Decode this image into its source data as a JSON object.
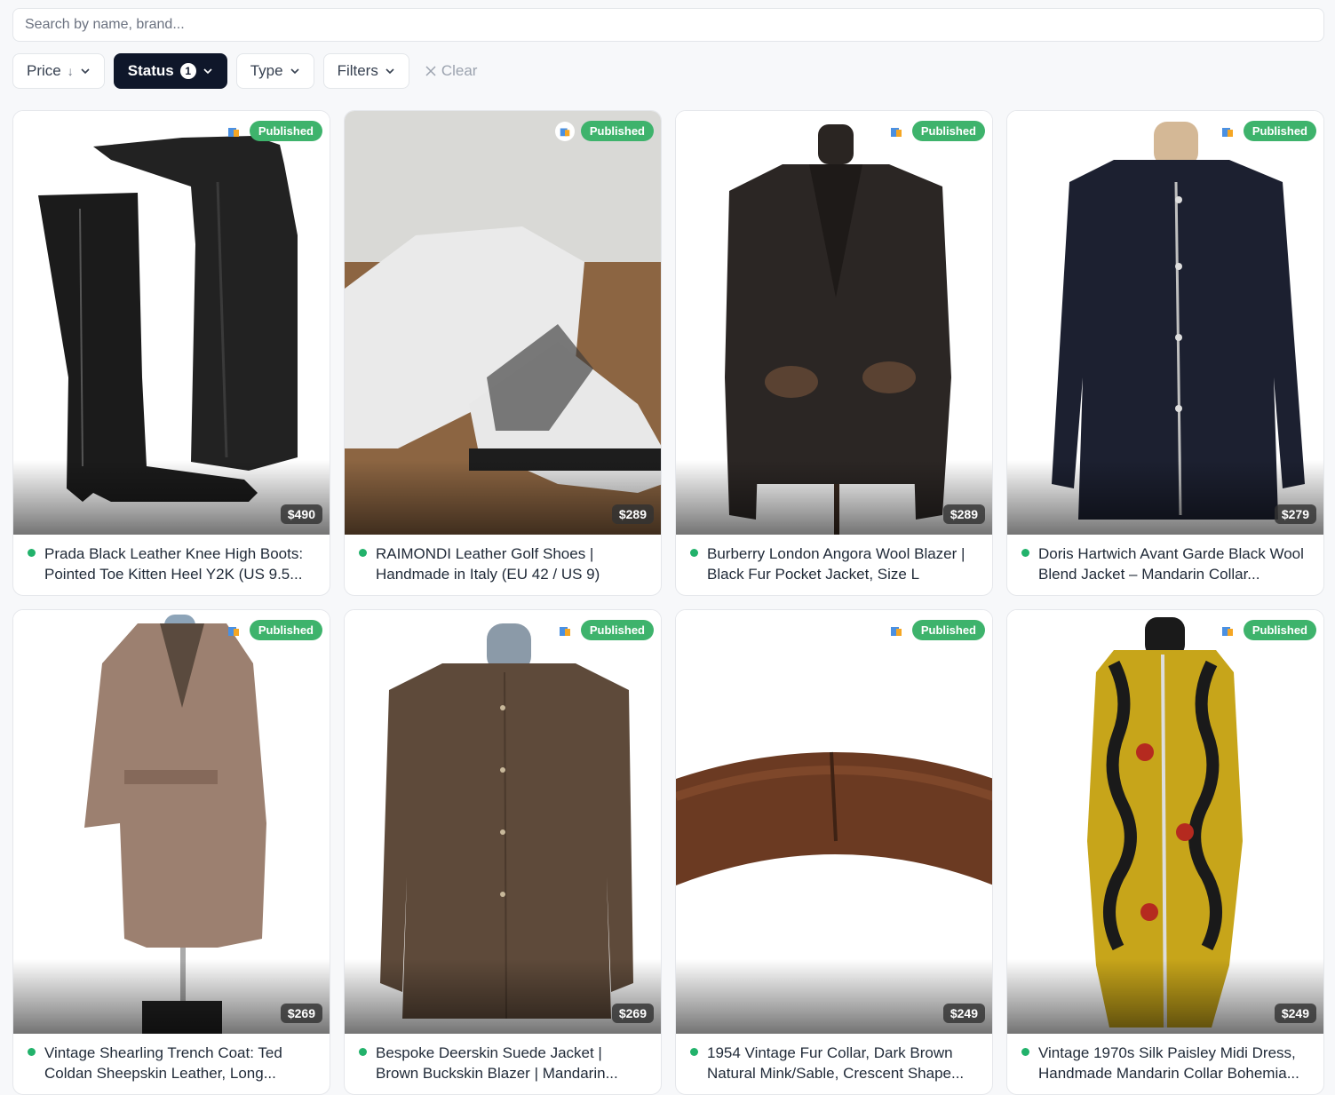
{
  "search": {
    "placeholder": "Search by name, brand..."
  },
  "filters": {
    "price": "Price",
    "status": "Status",
    "status_count": "1",
    "type": "Type",
    "more": "Filters",
    "clear": "Clear"
  },
  "products": [
    {
      "title": "Prada Black Leather Knee High Boots: Pointed Toe Kitten Heel Y2K (US 9.5...",
      "price": "$490",
      "status": "Published"
    },
    {
      "title": "RAIMONDI Leather Golf Shoes | Handmade in Italy (EU 42 / US 9)",
      "price": "$289",
      "status": "Published"
    },
    {
      "title": "Burberry London Angora Wool Blazer | Black Fur Pocket Jacket, Size L",
      "price": "$289",
      "status": "Published"
    },
    {
      "title": "Doris Hartwich Avant Garde Black Wool Blend Jacket – Mandarin Collar...",
      "price": "$279",
      "status": "Published"
    },
    {
      "title": "Vintage Shearling Trench Coat: Ted Coldan Sheepskin Leather, Long...",
      "price": "$269",
      "status": "Published"
    },
    {
      "title": "Bespoke Deerskin Suede Jacket | Brown Buckskin Blazer | Mandarin...",
      "price": "$269",
      "status": "Published"
    },
    {
      "title": "1954 Vintage Fur Collar, Dark Brown Natural Mink/Sable, Crescent Shape...",
      "price": "$249",
      "status": "Published"
    },
    {
      "title": "Vintage 1970s Silk Paisley Midi Dress, Handmade Mandarin Collar Bohemia...",
      "price": "$249",
      "status": "Published"
    }
  ],
  "colors": {
    "published": "#3eb36c",
    "active_filter": "#0f172a",
    "status_dot": "#22b26b"
  },
  "icons": [
    "arrow-down-icon",
    "chevron-down-icon",
    "close-icon",
    "shopping-bag-icon"
  ]
}
